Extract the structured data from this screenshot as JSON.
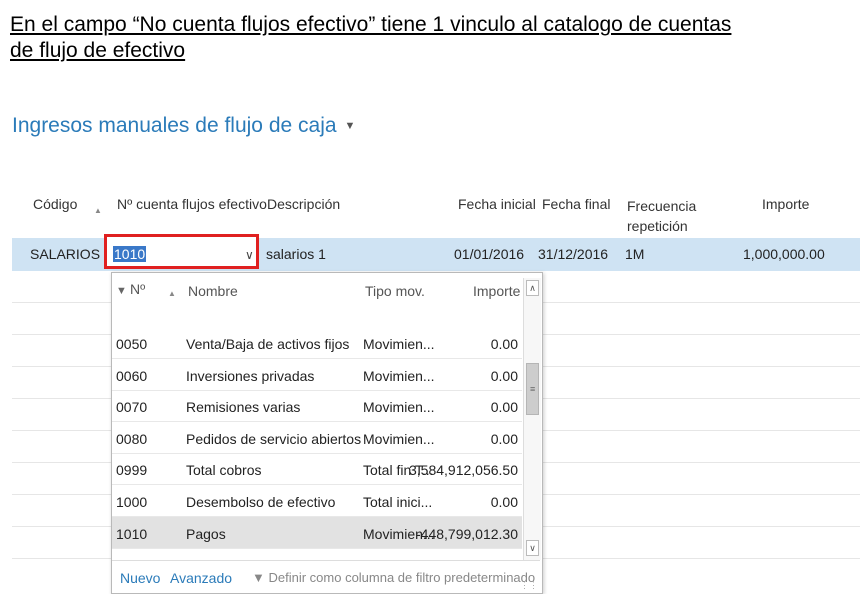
{
  "caption": {
    "line1": "En el  campo “No cuenta flujos efectivo” tiene 1 vinculo al catalogo de cuentas",
    "line2": "de flujo de efectivo"
  },
  "page": {
    "title": "Ingresos manuales de flujo de caja"
  },
  "columns": {
    "codigo": "Código",
    "cuenta": "Nº cuenta flujos efectivo",
    "descripcion": "Descripción",
    "fecha_inicial": "Fecha inicial",
    "fecha_final": "Fecha final",
    "frecuencia": "Frecuencia",
    "frecuencia2": "repetición",
    "importe": "Importe"
  },
  "row": {
    "codigo": "SALARIOS",
    "cuenta": "1010",
    "descripcion": "salarios 1",
    "fecha_inicial": "01/01/2016",
    "fecha_final": "31/12/2016",
    "frecuencia": "1M",
    "importe": "1,000,000.00"
  },
  "dropdown": {
    "headers": {
      "no": "Nº",
      "nombre": "Nombre",
      "tipo": "Tipo mov.",
      "importe": "Importe"
    },
    "rows": [
      {
        "no": "0050",
        "nombre": "Venta/Baja de activos fijos",
        "tipo": "Movimien...",
        "importe": "0.00"
      },
      {
        "no": "0060",
        "nombre": "Inversiones privadas",
        "tipo": "Movimien...",
        "importe": "0.00"
      },
      {
        "no": "0070",
        "nombre": "Remisiones varias",
        "tipo": "Movimien...",
        "importe": "0.00"
      },
      {
        "no": "0080",
        "nombre": "Pedidos de servicio abiertos",
        "tipo": "Movimien...",
        "importe": "0.00"
      },
      {
        "no": "0999",
        "nombre": "Total cobros",
        "tipo": "Total fin T...",
        "importe": "3,584,912,056.50"
      },
      {
        "no": "1000",
        "nombre": "Desembolso de efectivo",
        "tipo": "Total inici...",
        "importe": "0.00"
      },
      {
        "no": "1010",
        "nombre": "Pagos",
        "tipo": "Movimien...",
        "importe": "-448,799,012.30"
      }
    ],
    "footer": {
      "nuevo": "Nuevo",
      "avanzado": "Avanzado",
      "filtro": "Definir como columna de filtro predeterminado"
    }
  },
  "icons": [
    "chevron-down-icon",
    "sort-asc-icon",
    "filter-icon",
    "scroll-up-icon",
    "scroll-down-icon"
  ],
  "colors": {
    "accent": "#2b7bb9",
    "selected_row": "#cfe3f3",
    "highlight_border": "#e02020",
    "text_selection": "#3a78c8"
  }
}
